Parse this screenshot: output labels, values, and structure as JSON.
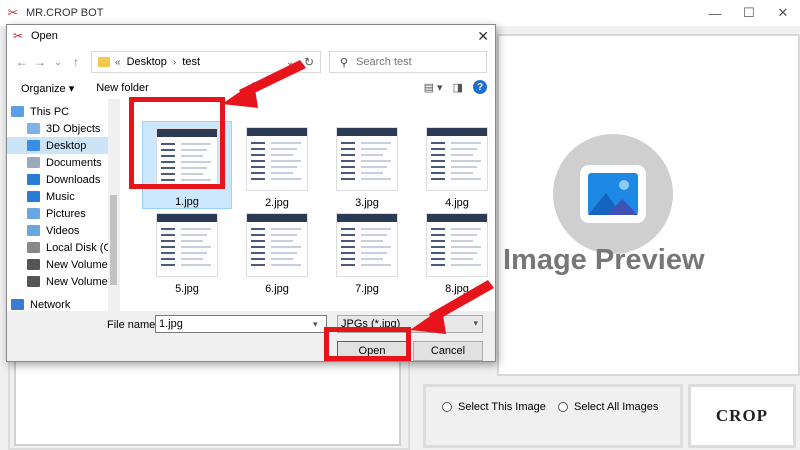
{
  "app": {
    "title": "MR.CROP BOT",
    "controls": {
      "minimize": "—",
      "maximize": "☐",
      "close": "✕"
    }
  },
  "dialog": {
    "title": "Open",
    "close": "✕",
    "path": {
      "prefix": "«",
      "crumbs": [
        "Desktop",
        "test"
      ]
    },
    "search_placeholder": "Search test",
    "toolbar": {
      "organize": "Organize ▾",
      "new_folder": "New folder"
    },
    "nav": [
      {
        "label": "This PC",
        "icon": "computer-icon",
        "color": "#5aa0e6"
      },
      {
        "label": "3D Objects",
        "icon": "cube-icon",
        "color": "#7fb2e5"
      },
      {
        "label": "Desktop",
        "icon": "desktop-icon",
        "color": "#3a8ee6"
      },
      {
        "label": "Documents",
        "icon": "document-icon",
        "color": "#9ab"
      },
      {
        "label": "Downloads",
        "icon": "download-icon",
        "color": "#2a7bd4"
      },
      {
        "label": "Music",
        "icon": "music-icon",
        "color": "#2a7bd4"
      },
      {
        "label": "Pictures",
        "icon": "pictures-icon",
        "color": "#6aa6e0"
      },
      {
        "label": "Videos",
        "icon": "videos-icon",
        "color": "#6aa6e0"
      },
      {
        "label": "Local Disk (C:)",
        "icon": "disk-icon",
        "color": "#888"
      },
      {
        "label": "New Volume (",
        "icon": "drive-icon",
        "color": "#555"
      },
      {
        "label": "New Volume (",
        "icon": "drive-icon",
        "color": "#555"
      },
      {
        "label": "Network",
        "icon": "network-icon",
        "color": "#3a7bd4"
      }
    ],
    "files": [
      "1.jpg",
      "2.jpg",
      "3.jpg",
      "4.jpg",
      "5.jpg",
      "6.jpg",
      "7.jpg",
      "8.jpg"
    ],
    "file_name_label": "File name:",
    "file_name_value": "1.jpg",
    "file_type": "JPGs (*.jpg)",
    "open_label": "Open",
    "cancel_label": "Cancel"
  },
  "preview": {
    "text": "Image Preview"
  },
  "options": {
    "select_this": "Select This Image",
    "select_all": "Select All Images"
  },
  "crop_label": "CROP",
  "highlight_color": "#e8141b"
}
